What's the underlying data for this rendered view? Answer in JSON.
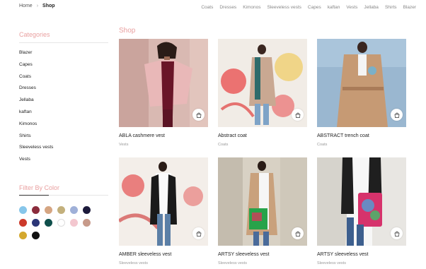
{
  "breadcrumb": {
    "home": "Home",
    "current": "Shop"
  },
  "topnav": [
    "Coats",
    "Dresses",
    "Kimonos",
    "Sleeveless vests",
    "Capes",
    "kaftan",
    "Vests",
    "Jellaba",
    "Shirts",
    "Blazer"
  ],
  "sidebar": {
    "categories_title": "Categories",
    "categories": [
      "Blazer",
      "Capes",
      "Coats",
      "Dresses",
      "Jellaba",
      "kaftan",
      "Kimonos",
      "Shirts",
      "Sleeveless vests",
      "Vests"
    ],
    "color_title": "Filter By Color",
    "colors": [
      "#87c6ea",
      "#8b2c3c",
      "#d5a582",
      "#c3b07c",
      "#9fb0d8",
      "#1c1a3b",
      "#cc3a2b",
      "#2b3577",
      "#0f4f4b",
      "#ffffff",
      "#f3c7cf",
      "#c79a8a",
      "#d4a82e",
      "#111111"
    ]
  },
  "main": {
    "title": "Shop",
    "products": [
      {
        "name": "ABLA cashmere vest",
        "category": "Vests"
      },
      {
        "name": "Abstract coat",
        "category": "Coats"
      },
      {
        "name": "ABSTRACT trench coat",
        "category": "Coats"
      },
      {
        "name": "AMBER sleeveless vest",
        "category": "Sleeveless vests"
      },
      {
        "name": "ARTSY sleeveless vest",
        "category": "Sleeveless vests"
      },
      {
        "name": "ARTSY sleeveless vest",
        "category": "Sleeveless vests"
      }
    ]
  }
}
